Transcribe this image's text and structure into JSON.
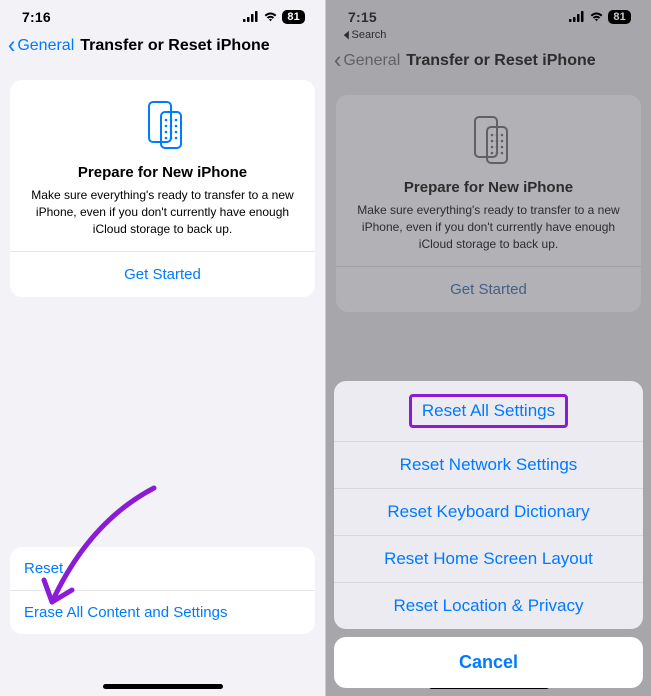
{
  "left": {
    "time": "7:16",
    "battery": "81",
    "back_label": "General",
    "title": "Transfer or Reset iPhone",
    "prepare_title": "Prepare for New iPhone",
    "prepare_desc": "Make sure everything's ready to transfer to a new iPhone, even if you don't currently have enough iCloud storage to back up.",
    "get_started": "Get Started",
    "list": {
      "reset": "Reset",
      "erase": "Erase All Content and Settings"
    },
    "icon_color": "#007aff"
  },
  "right": {
    "time": "7:15",
    "battery": "81",
    "breadcrumb": "Search",
    "back_label": "General",
    "title": "Transfer or Reset iPhone",
    "prepare_title": "Prepare for New iPhone",
    "prepare_desc": "Make sure everything's ready to transfer to a new iPhone, even if you don't currently have enough iCloud storage to back up.",
    "get_started": "Get Started",
    "icon_color": "#7c7c82",
    "action_sheet": {
      "options": [
        "Reset All Settings",
        "Reset Network Settings",
        "Reset Keyboard Dictionary",
        "Reset Home Screen Layout",
        "Reset Location & Privacy"
      ],
      "cancel": "Cancel"
    }
  }
}
